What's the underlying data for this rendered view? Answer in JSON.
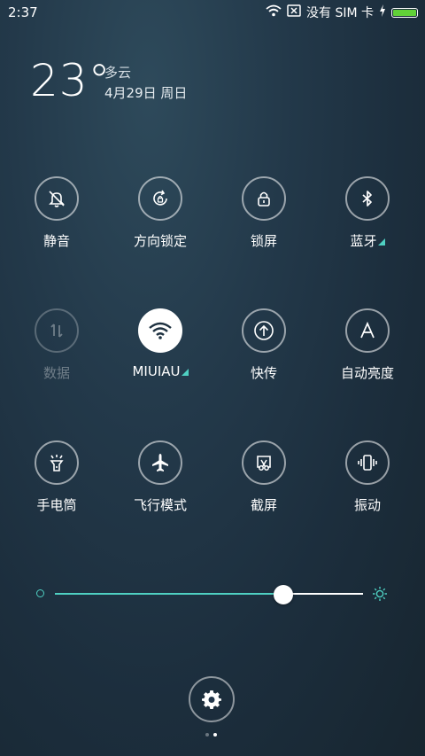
{
  "status_bar": {
    "time": "2:37",
    "carrier_text": "没有 SIM 卡",
    "icons": [
      "wifi-icon",
      "no-sim-icon",
      "charging-icon",
      "battery-icon"
    ],
    "battery_color": "#61d138"
  },
  "weather": {
    "temperature": "23°",
    "condition": "多云",
    "date": "4月29日 周日"
  },
  "toggles": [
    {
      "label": "静音",
      "icon": "bell-off-icon",
      "state": "off"
    },
    {
      "label": "方向锁定",
      "icon": "rotation-lock-icon",
      "state": "off"
    },
    {
      "label": "锁屏",
      "icon": "lock-icon",
      "state": "off"
    },
    {
      "label": "蓝牙",
      "icon": "bluetooth-icon",
      "state": "off",
      "has_more": true
    },
    {
      "label": "数据",
      "icon": "mobile-data-icon",
      "state": "disabled"
    },
    {
      "label": "MIUIAU",
      "icon": "wifi-icon",
      "state": "on",
      "has_more": true
    },
    {
      "label": "快传",
      "icon": "upload-icon",
      "state": "off"
    },
    {
      "label": "自动亮度",
      "icon": "auto-brightness-icon",
      "state": "off"
    },
    {
      "label": "手电筒",
      "icon": "flashlight-icon",
      "state": "off"
    },
    {
      "label": "飞行模式",
      "icon": "airplane-icon",
      "state": "off"
    },
    {
      "label": "截屏",
      "icon": "screenshot-icon",
      "state": "off"
    },
    {
      "label": "振动",
      "icon": "vibrate-icon",
      "state": "off"
    }
  ],
  "brightness": {
    "level": 0.74,
    "accent_color": "#4fd0c2"
  },
  "pager": {
    "pages": 2,
    "current": 2
  }
}
